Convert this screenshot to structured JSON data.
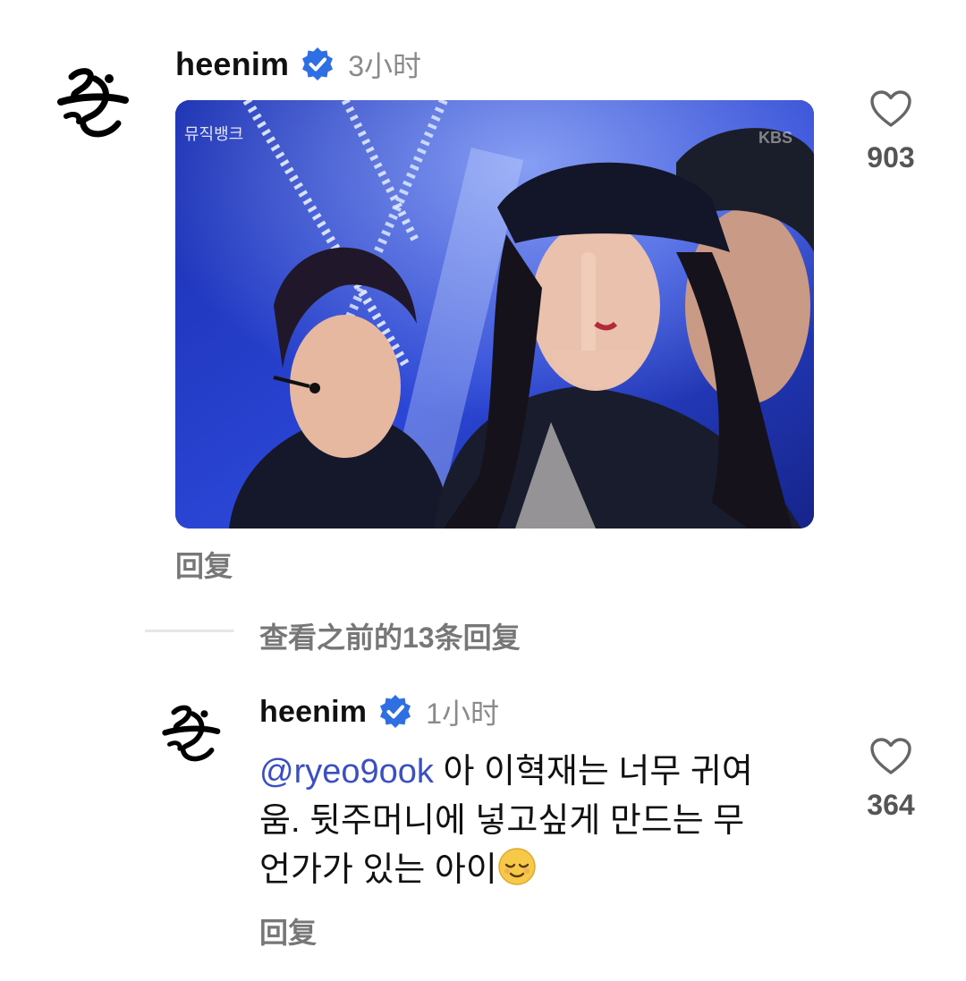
{
  "post": {
    "username": "heenim",
    "time": "3小时",
    "reply_label": "回复",
    "like_count": "903",
    "media_corner_logo": "뮤직뱅크",
    "media_watermark": "KBS"
  },
  "thread": {
    "view_more_label": "查看之前的13条回复"
  },
  "reply": {
    "username": "heenim",
    "time": "1小时",
    "mention": "ryeo9ook",
    "text_line1": " 아 이혁재는 너무 귀여",
    "text_line2": "움. 뒷주머니에 넣고싶게 만드는 무",
    "text_line3": "언가가 있는 아이",
    "emoji": "relieved-face-emoji",
    "reply_label": "回复",
    "like_count": "364"
  },
  "colors": {
    "verified_blue": "#2f6fe4",
    "mention_color": "#3b4fc4",
    "muted_text": "#8a8a8a"
  }
}
